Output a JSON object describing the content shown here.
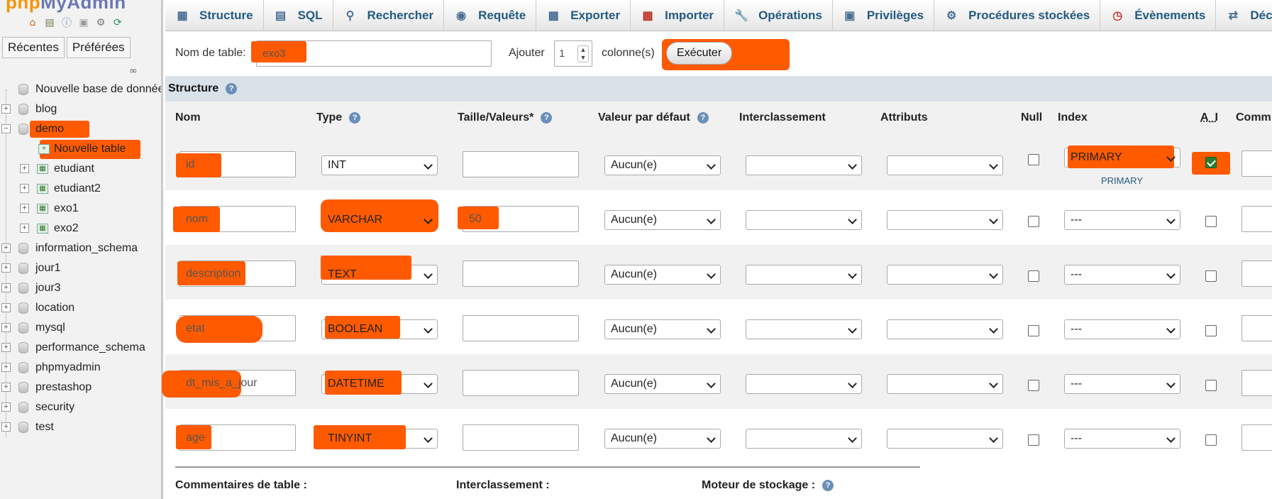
{
  "sidebar": {
    "logo_php": "php",
    "logo_my": "MyAdmin",
    "icons": [
      "home-icon",
      "exit-icon",
      "help-icon",
      "docs-icon",
      "settings-icon",
      "reload-icon"
    ],
    "tab_recent": "Récentes",
    "tab_favorites": "Préférées",
    "tree": [
      {
        "label": "Nouvelle base de données",
        "type": "new-db"
      },
      {
        "label": "blog",
        "type": "db"
      },
      {
        "label": "demo",
        "type": "db",
        "expanded": true
      },
      {
        "label": "Nouvelle table",
        "type": "new-table"
      },
      {
        "label": "etudiant",
        "type": "table"
      },
      {
        "label": "etudiant2",
        "type": "table"
      },
      {
        "label": "exo1",
        "type": "table"
      },
      {
        "label": "exo2",
        "type": "table"
      },
      {
        "label": "information_schema",
        "type": "db"
      },
      {
        "label": "jour1",
        "type": "db"
      },
      {
        "label": "jour3",
        "type": "db"
      },
      {
        "label": "location",
        "type": "db"
      },
      {
        "label": "mysql",
        "type": "db"
      },
      {
        "label": "performance_schema",
        "type": "db"
      },
      {
        "label": "phpmyadmin",
        "type": "db"
      },
      {
        "label": "prestashop",
        "type": "db"
      },
      {
        "label": "security",
        "type": "db"
      },
      {
        "label": "test",
        "type": "db"
      }
    ]
  },
  "topnav": [
    {
      "label": "Structure",
      "icon": "structure-icon"
    },
    {
      "label": "SQL",
      "icon": "sql-icon"
    },
    {
      "label": "Rechercher",
      "icon": "search-icon"
    },
    {
      "label": "Requête",
      "icon": "query-icon"
    },
    {
      "label": "Exporter",
      "icon": "export-icon"
    },
    {
      "label": "Importer",
      "icon": "import-icon"
    },
    {
      "label": "Opérations",
      "icon": "wrench-icon"
    },
    {
      "label": "Privilèges",
      "icon": "privileges-icon"
    },
    {
      "label": "Procédures stockées",
      "icon": "routines-icon"
    },
    {
      "label": "Évènements",
      "icon": "clock-icon"
    },
    {
      "label": "Déclencheurs",
      "icon": "triggers-icon"
    }
  ],
  "form": {
    "table_name_label": "Nom de table:",
    "table_name_value": "exo3",
    "add_label": "Ajouter",
    "add_count": "1",
    "columns_label": "colonne(s)",
    "execute_label": "Exécuter"
  },
  "structure": {
    "title": "Structure",
    "headers": {
      "name": "Nom",
      "type": "Type",
      "length": "Taille/Valeurs*",
      "default": "Valeur par défaut",
      "collation": "Interclassement",
      "attributes": "Attributs",
      "null": "Null",
      "index": "Index",
      "ai": "A_I",
      "comments": "Comm"
    },
    "rows": [
      {
        "name": "id",
        "type": "INT",
        "length": "",
        "default": "Aucun(e)",
        "collation": "",
        "attributes": "",
        "null": false,
        "index": "PRIMARY",
        "index_note": "PRIMARY",
        "ai": true
      },
      {
        "name": "nom",
        "type": "VARCHAR",
        "length": "50",
        "default": "Aucun(e)",
        "collation": "",
        "attributes": "",
        "null": false,
        "index": "---",
        "index_note": "",
        "ai": false
      },
      {
        "name": "description",
        "type": "TEXT",
        "length": "",
        "default": "Aucun(e)",
        "collation": "",
        "attributes": "",
        "null": false,
        "index": "---",
        "index_note": "",
        "ai": false
      },
      {
        "name": "etat",
        "type": "BOOLEAN",
        "length": "",
        "default": "Aucun(e)",
        "collation": "",
        "attributes": "",
        "null": false,
        "index": "---",
        "index_note": "",
        "ai": false
      },
      {
        "name": "dt_mis_a_jour",
        "type": "DATETIME",
        "length": "",
        "default": "Aucun(e)",
        "collation": "",
        "attributes": "",
        "null": false,
        "index": "---",
        "index_note": "",
        "ai": false
      },
      {
        "name": "age",
        "type": "TINYINT",
        "length": "",
        "default": "Aucun(e)",
        "collation": "",
        "attributes": "",
        "null": false,
        "index": "---",
        "index_note": "",
        "ai": false
      }
    ]
  },
  "footer": {
    "table_comments": "Commentaires de table :",
    "collation": "Interclassement :",
    "storage_engine": "Moteur de stockage :"
  },
  "colors": {
    "nav_text": "#235a81",
    "redaction": "#ff5a00",
    "section_bar": "#d9e1e9",
    "checked": "#2e7d32"
  }
}
